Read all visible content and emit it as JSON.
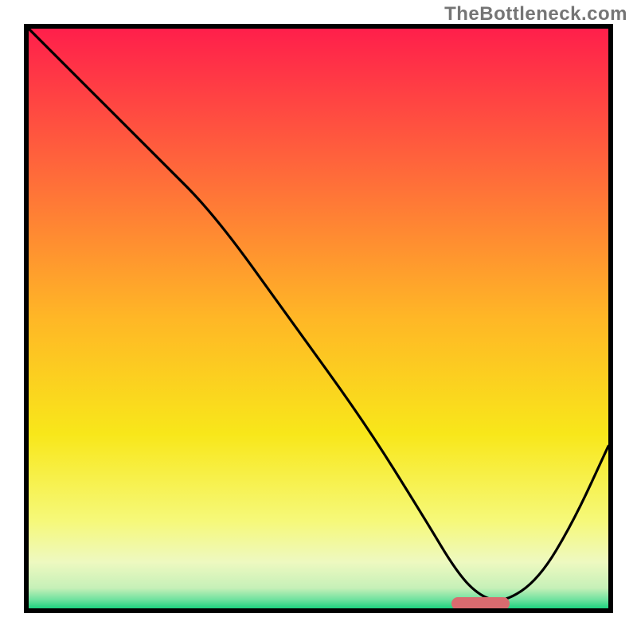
{
  "watermark": "TheBottleneck.com",
  "colors": {
    "border": "#000000",
    "curve": "#000000",
    "marker": "#d96b6f",
    "gradient_stops": [
      {
        "offset": 0.0,
        "color": "#ff1f4b"
      },
      {
        "offset": 0.25,
        "color": "#ff6a3a"
      },
      {
        "offset": 0.5,
        "color": "#ffb726"
      },
      {
        "offset": 0.7,
        "color": "#f8e71a"
      },
      {
        "offset": 0.85,
        "color": "#f6f97a"
      },
      {
        "offset": 0.92,
        "color": "#eef9c0"
      },
      {
        "offset": 0.965,
        "color": "#c6f0b8"
      },
      {
        "offset": 0.985,
        "color": "#6fe29f"
      },
      {
        "offset": 1.0,
        "color": "#1ed27f"
      }
    ]
  },
  "chart_data": {
    "type": "line",
    "title": "",
    "xlabel": "",
    "ylabel": "",
    "xlim": [
      0,
      100
    ],
    "ylim": [
      0,
      100
    ],
    "x": [
      0,
      22,
      32,
      45,
      58,
      68,
      74,
      78,
      82,
      88,
      94,
      100
    ],
    "values": [
      100,
      78,
      68,
      50,
      32,
      16,
      6,
      2,
      1,
      5,
      15,
      28
    ],
    "legend": false,
    "grid": false,
    "marker_segment": {
      "x_start": 73,
      "x_end": 83,
      "y": 0.5
    }
  }
}
